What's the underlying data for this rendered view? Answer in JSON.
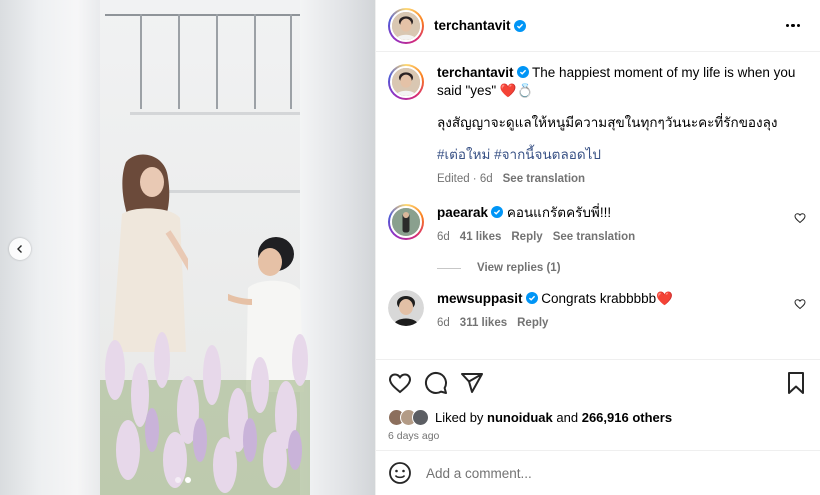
{
  "post": {
    "author": "terchantavit",
    "caption_text": "The happiest moment of my life is when you said \"yes\"",
    "caption_emoji": "❤️💍",
    "caption_line2": "ลุงสัญญาจะดูแลให้หนูมีความสุขในทุกๆวันนะคะที่รักของลุง",
    "hashtags": "#เต่อใหม่ #จากนี้จนตลอดไป",
    "edited_age": "Edited · 6d",
    "see_translation": "See translation"
  },
  "comments": [
    {
      "username": "paearak",
      "text": "คอนแกรัตครับพี่!!!",
      "age": "6d",
      "likes": "41 likes",
      "reply": "Reply",
      "see_translation": "See translation",
      "view_replies": "View replies (1)"
    },
    {
      "username": "mewsuppasit",
      "text": "Congrats krabbbbb",
      "emoji": "❤️",
      "age": "6d",
      "likes": "311 likes",
      "reply": "Reply"
    }
  ],
  "likes": {
    "prefix": "Liked by",
    "user": "nunoiduak",
    "connector": "and",
    "others": "266,916 others"
  },
  "timestamp": "6 days ago",
  "comment_box": {
    "placeholder": "Add a comment..."
  },
  "colors": {
    "verified": "#0095f6",
    "heart": "#ed4956",
    "hashtag": "#385185",
    "muted": "#737373"
  },
  "icons": [
    "more-options-icon",
    "verified-badge-icon",
    "heart-icon",
    "comment-icon",
    "share-icon",
    "save-icon",
    "emoji-icon",
    "chevron-left-icon"
  ],
  "carousel": {
    "current": 2,
    "total": 2
  }
}
